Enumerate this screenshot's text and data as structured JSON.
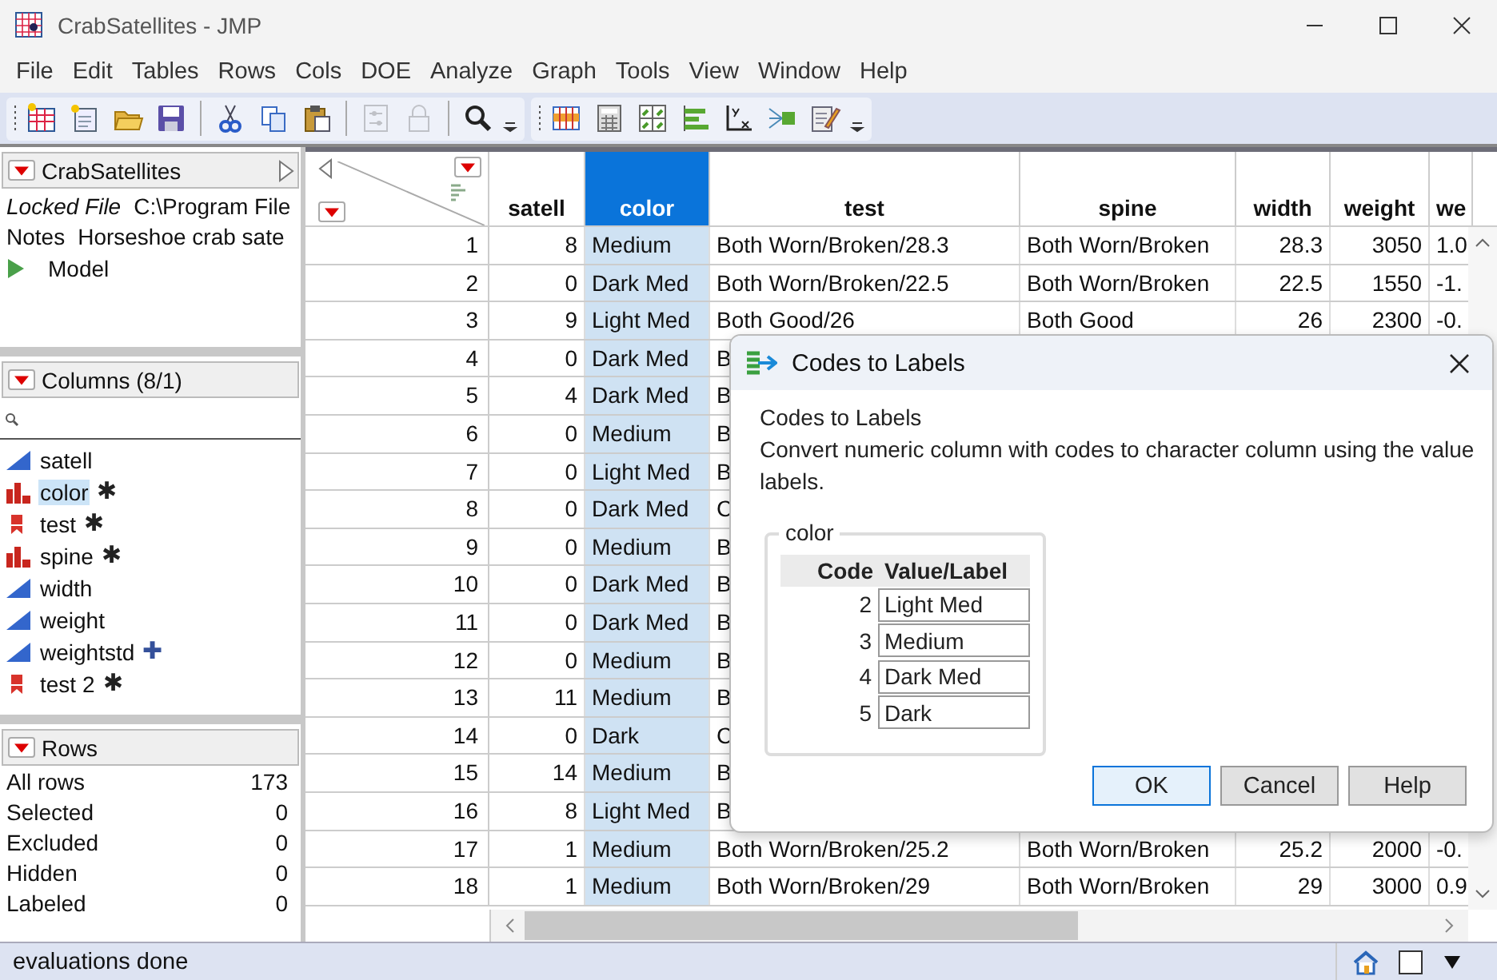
{
  "window": {
    "title": "CrabSatellites - JMP"
  },
  "menu": [
    "File",
    "Edit",
    "Tables",
    "Rows",
    "Cols",
    "DOE",
    "Analyze",
    "Graph",
    "Tools",
    "View",
    "Window",
    "Help"
  ],
  "toolbar": {
    "groups": [
      [
        {
          "kind": "new-table",
          "disabled": false
        },
        {
          "kind": "new-script",
          "disabled": false
        },
        {
          "kind": "open",
          "disabled": false
        },
        {
          "kind": "save",
          "disabled": false,
          "separator_after": true
        },
        {
          "kind": "cut",
          "disabled": false
        },
        {
          "kind": "copy",
          "disabled": false
        },
        {
          "kind": "paste",
          "disabled": false,
          "separator_after": true
        },
        {
          "kind": "sliders",
          "disabled": true
        },
        {
          "kind": "lock",
          "disabled": true,
          "separator_after": true
        },
        {
          "kind": "search",
          "disabled": false
        }
      ],
      [
        {
          "kind": "data-grid",
          "disabled": false
        },
        {
          "kind": "calculator",
          "disabled": false
        },
        {
          "kind": "quad",
          "disabled": false
        },
        {
          "kind": "bars",
          "disabled": false
        },
        {
          "kind": "yx",
          "disabled": false
        },
        {
          "kind": "connect",
          "disabled": false
        },
        {
          "kind": "pencil",
          "disabled": false
        }
      ]
    ]
  },
  "table_panel": {
    "title": "CrabSatellites",
    "items": [
      {
        "kind": "property",
        "label": "Locked File",
        "italic": true,
        "value": "C:\\Program File"
      },
      {
        "kind": "property",
        "label": "Notes",
        "italic": false,
        "value": "Horseshoe crab sate"
      },
      {
        "kind": "script",
        "label": "Model"
      }
    ]
  },
  "columns_panel": {
    "title": "Columns (8/1)",
    "columns": [
      {
        "name": "satell",
        "kind": "continuous",
        "selected": false
      },
      {
        "name": "color",
        "kind": "nominal",
        "badge": "✱",
        "selected": true
      },
      {
        "name": "test",
        "kind": "character",
        "badge": "✱",
        "selected": false
      },
      {
        "name": "spine",
        "kind": "nominal",
        "badge": "✱",
        "selected": false
      },
      {
        "name": "width",
        "kind": "continuous",
        "selected": false
      },
      {
        "name": "weight",
        "kind": "continuous",
        "selected": false
      },
      {
        "name": "weightstd",
        "kind": "continuous",
        "badge": "✚",
        "selected": false
      },
      {
        "name": "test 2",
        "kind": "character",
        "badge": "✱",
        "selected": false
      }
    ]
  },
  "rows_panel": {
    "title": "Rows",
    "stats": [
      {
        "label": "All rows",
        "value": "173"
      },
      {
        "label": "Selected",
        "value": "0"
      },
      {
        "label": "Excluded",
        "value": "0"
      },
      {
        "label": "Hidden",
        "value": "0"
      },
      {
        "label": "Labeled",
        "value": "0"
      }
    ]
  },
  "table": {
    "columns": [
      {
        "name": "satell",
        "numeric": true,
        "selected": false
      },
      {
        "name": "color",
        "numeric": false,
        "selected": true
      },
      {
        "name": "test",
        "numeric": false,
        "selected": false
      },
      {
        "name": "spine",
        "numeric": false,
        "selected": false
      },
      {
        "name": "width",
        "numeric": true,
        "selected": false
      },
      {
        "name": "weight",
        "numeric": true,
        "selected": false
      },
      {
        "name": "we",
        "numeric": false,
        "selected": false
      }
    ],
    "rows": [
      {
        "number": "1",
        "cells": [
          "8",
          "Medium",
          "Both Worn/Broken/28.3",
          "Both Worn/Broken",
          "28.3",
          "3050",
          "1.0"
        ]
      },
      {
        "number": "2",
        "cells": [
          "0",
          "Dark Med",
          "Both Worn/Broken/22.5",
          "Both Worn/Broken",
          "22.5",
          "1550",
          "-1."
        ]
      },
      {
        "number": "3",
        "cells": [
          "9",
          "Light Med",
          "Both Good/26",
          "Both Good",
          "26",
          "2300",
          "-0."
        ]
      },
      {
        "number": "4",
        "cells": [
          "0",
          "Dark Med",
          "B"
        ]
      },
      {
        "number": "5",
        "cells": [
          "4",
          "Dark Med",
          "B"
        ]
      },
      {
        "number": "6",
        "cells": [
          "0",
          "Medium",
          "B"
        ]
      },
      {
        "number": "7",
        "cells": [
          "0",
          "Light Med",
          "B"
        ]
      },
      {
        "number": "8",
        "cells": [
          "0",
          "Dark Med",
          "C"
        ]
      },
      {
        "number": "9",
        "cells": [
          "0",
          "Medium",
          "B"
        ]
      },
      {
        "number": "10",
        "cells": [
          "0",
          "Dark Med",
          "B"
        ]
      },
      {
        "number": "11",
        "cells": [
          "0",
          "Dark Med",
          "B"
        ]
      },
      {
        "number": "12",
        "cells": [
          "0",
          "Medium",
          "B"
        ]
      },
      {
        "number": "13",
        "cells": [
          "11",
          "Medium",
          "B"
        ]
      },
      {
        "number": "14",
        "cells": [
          "0",
          "Dark",
          "C"
        ]
      },
      {
        "number": "15",
        "cells": [
          "14",
          "Medium",
          "B"
        ]
      },
      {
        "number": "16",
        "cells": [
          "8",
          "Light Med",
          "B"
        ]
      },
      {
        "number": "17",
        "cells": [
          "1",
          "Medium",
          "Both Worn/Broken/25.2",
          "Both Worn/Broken",
          "25.2",
          "2000",
          "-0."
        ]
      },
      {
        "number": "18",
        "cells": [
          "1",
          "Medium",
          "Both Worn/Broken/29",
          "Both Worn/Broken",
          "29",
          "3000",
          "0.9"
        ]
      }
    ]
  },
  "dialog": {
    "title": "Codes to Labels",
    "heading": "Codes to Labels",
    "description": "Convert numeric column with codes to character column using the value labels.",
    "group": "color",
    "code_header": "Code",
    "label_header": "Value/Label",
    "entries": [
      {
        "code": "2",
        "label": "Light Med"
      },
      {
        "code": "3",
        "label": "Medium"
      },
      {
        "code": "4",
        "label": "Dark Med"
      },
      {
        "code": "5",
        "label": "Dark"
      }
    ],
    "buttons": [
      {
        "label": "OK",
        "default": true
      },
      {
        "label": "Cancel",
        "default": false
      },
      {
        "label": "Help",
        "default": false
      }
    ]
  },
  "status_bar": {
    "text": "evaluations done"
  }
}
